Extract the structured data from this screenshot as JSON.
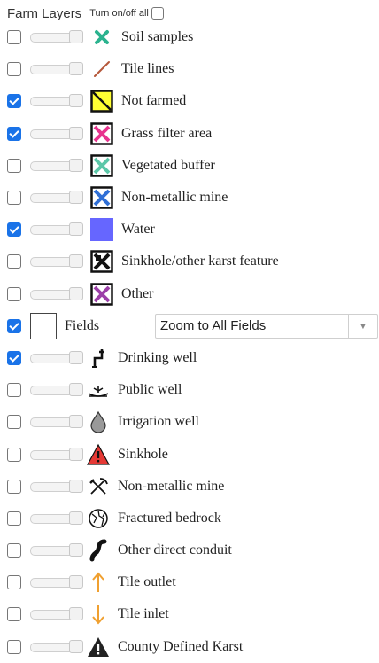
{
  "header": {
    "title": "Farm Layers",
    "toggle_all_label": "Turn on/off all",
    "toggle_all_checked": false
  },
  "layers": [
    {
      "label": "Soil samples",
      "checked": false,
      "icon": "x-mark-icon"
    },
    {
      "label": "Tile lines",
      "checked": false,
      "icon": "diagonal-line-icon"
    },
    {
      "label": "Not farmed",
      "checked": true,
      "icon": "yellow-hatch-swatch-icon"
    },
    {
      "label": "Grass filter area",
      "checked": true,
      "icon": "pink-x-swatch-icon"
    },
    {
      "label": "Vegetated buffer",
      "checked": false,
      "icon": "teal-x-swatch-icon"
    },
    {
      "label": "Non-metallic mine",
      "checked": false,
      "icon": "blue-x-swatch-icon"
    },
    {
      "label": "Water",
      "checked": true,
      "icon": "water-swatch-icon"
    },
    {
      "label": "Sinkhole/other karst feature",
      "checked": false,
      "icon": "black-x-swatch-icon"
    },
    {
      "label": "Other",
      "checked": false,
      "icon": "purple-x-swatch-icon"
    }
  ],
  "fields": {
    "label": "Fields",
    "checked": true,
    "zoom_select": {
      "selected": "Zoom to All Fields"
    }
  },
  "points": [
    {
      "label": "Drinking well",
      "checked": true,
      "icon": "faucet-icon"
    },
    {
      "label": "Public well",
      "checked": false,
      "icon": "public-well-icon"
    },
    {
      "label": "Irrigation well",
      "checked": false,
      "icon": "droplet-icon"
    },
    {
      "label": "Sinkhole",
      "checked": false,
      "icon": "warning-triangle-icon"
    },
    {
      "label": "Non-metallic mine",
      "checked": false,
      "icon": "crossed-tools-icon"
    },
    {
      "label": "Fractured bedrock",
      "checked": false,
      "icon": "fractured-rock-icon"
    },
    {
      "label": "Other direct conduit",
      "checked": false,
      "icon": "conduit-icon"
    },
    {
      "label": "Tile outlet",
      "checked": false,
      "icon": "arrow-up-icon"
    },
    {
      "label": "Tile inlet",
      "checked": false,
      "icon": "arrow-down-icon"
    },
    {
      "label": "County Defined Karst",
      "checked": false,
      "icon": "karst-triangle-icon"
    }
  ],
  "colors": {
    "checkbox_checked": "#1a73e8",
    "soil_sample": "#2bb38f",
    "tile_line": "#b5583a",
    "water": "#6666ff",
    "arrow": "#f0a030",
    "warning": "#e53935"
  }
}
